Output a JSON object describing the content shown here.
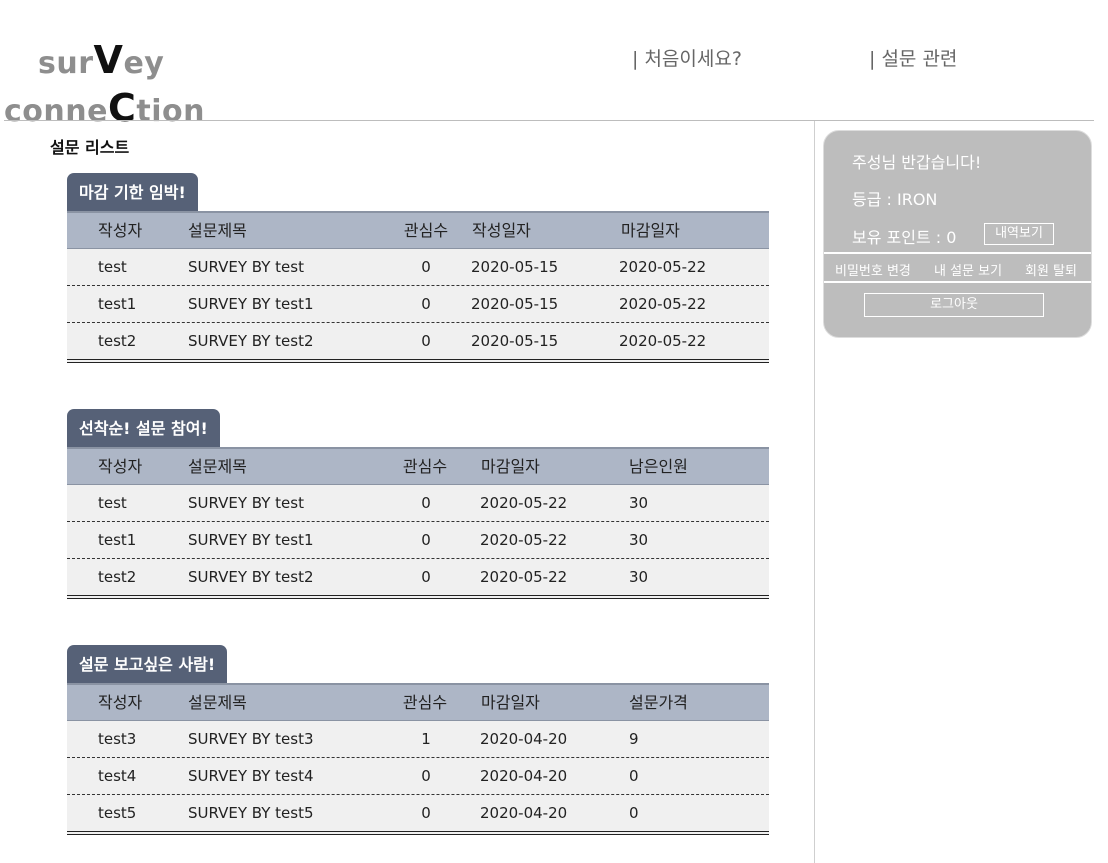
{
  "logo": {
    "line1_pre": "sur",
    "line1_cap": "V",
    "line1_post": "ey",
    "line2_pre": "conne",
    "line2_cap": "C",
    "line2_post": "tion"
  },
  "nav": {
    "first_visit": "| 처음이세요?",
    "survey_related": "| 설문 관련"
  },
  "section_title": "설문 리스트",
  "tables": [
    {
      "tab": "마감 기한 임박!",
      "headers": [
        "작성자",
        "설문제목",
        "관심수",
        "작성일자",
        "마감일자"
      ],
      "rows": [
        [
          "test",
          "SURVEY BY test",
          "0",
          "2020-05-15",
          "2020-05-22"
        ],
        [
          "test1",
          "SURVEY BY test1",
          "0",
          "2020-05-15",
          "2020-05-22"
        ],
        [
          "test2",
          "SURVEY BY test2",
          "0",
          "2020-05-15",
          "2020-05-22"
        ]
      ]
    },
    {
      "tab": "선착순! 설문 참여!",
      "headers": [
        "작성자",
        "설문제목",
        "관심수",
        "마감일자",
        "남은인원"
      ],
      "rows": [
        [
          "test",
          "SURVEY BY test",
          "0",
          "2020-05-22",
          "30"
        ],
        [
          "test1",
          "SURVEY BY test1",
          "0",
          "2020-05-22",
          "30"
        ],
        [
          "test2",
          "SURVEY BY test2",
          "0",
          "2020-05-22",
          "30"
        ]
      ]
    },
    {
      "tab": "설문 보고싶은 사람!",
      "headers": [
        "작성자",
        "설문제목",
        "관심수",
        "마감일자",
        "설문가격"
      ],
      "rows": [
        [
          "test3",
          "SURVEY BY test3",
          "1",
          "2020-04-20",
          "9"
        ],
        [
          "test4",
          "SURVEY BY test4",
          "0",
          "2020-04-20",
          "0"
        ],
        [
          "test5",
          "SURVEY BY test5",
          "0",
          "2020-04-20",
          "0"
        ]
      ]
    }
  ],
  "panel": {
    "greeting": "주성님 반갑습니다!",
    "grade": "등급 : IRON",
    "points": "보유 포인트 : 0",
    "history_button": "내역보기",
    "change_password": "비밀번호 변경",
    "my_surveys": "내 설문 보기",
    "withdraw": "회원 탈퇴",
    "logout": "로그아웃"
  },
  "colors": {
    "tab_bg": "#566177",
    "header_bg": "#adb6c6",
    "row_bg": "#f0f0f0",
    "panel_bg": "#bdbdbd",
    "logo_gray": "#8e8e8e"
  }
}
